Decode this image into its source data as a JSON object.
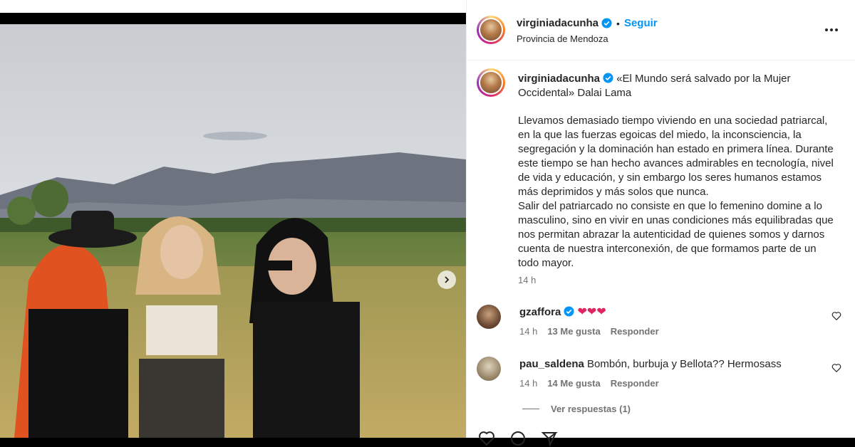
{
  "post": {
    "username": "virginiadacunha",
    "follow_label": "Seguir",
    "separator": "•",
    "location": "Provincia de Mendoza",
    "caption_first": "«El Mundo será salvado por la Mujer Occidental» Dalai Lama",
    "caption_body": "Llevamos demasiado tiempo viviendo en una sociedad patriarcal, en la que las fuerzas egoicas del miedo, la inconsciencia, la segregación y la dominación han estado en primera línea. Durante este tiempo se han hecho avances admirables en tecnología, nivel de vida y educación, y sin embargo los seres humanos estamos más deprimidos y más solos que nunca.\nSalir del patriarcado no consiste en que lo femenino domine a lo masculino, sino en vivir en unas condiciones más equilibradas que nos permitan abrazar la autenticidad de quienes somos y darnos cuenta de nuestra interconexión, de que formamos parte de un todo mayor.",
    "time": "14 h"
  },
  "comments": [
    {
      "username": "gzaffora",
      "text": "❤❤❤",
      "time": "14 h",
      "likes": "13 Me gusta",
      "reply": "Responder"
    },
    {
      "username": "pau_saldena",
      "text": "Bombón, burbuja y Bellota?? Hermosass",
      "time": "14 h",
      "likes": "14 Me gusta",
      "reply": "Responder"
    }
  ],
  "view_replies": "Ver respuestas (1)",
  "colors": {
    "accent": "#0095f6",
    "verified": "#0095f6",
    "heart_emoji": "#e0245e"
  },
  "icons": [
    "verified-badge-icon",
    "more-options-icon",
    "next-photo-icon",
    "like-icon",
    "comment-icon",
    "share-icon"
  ]
}
